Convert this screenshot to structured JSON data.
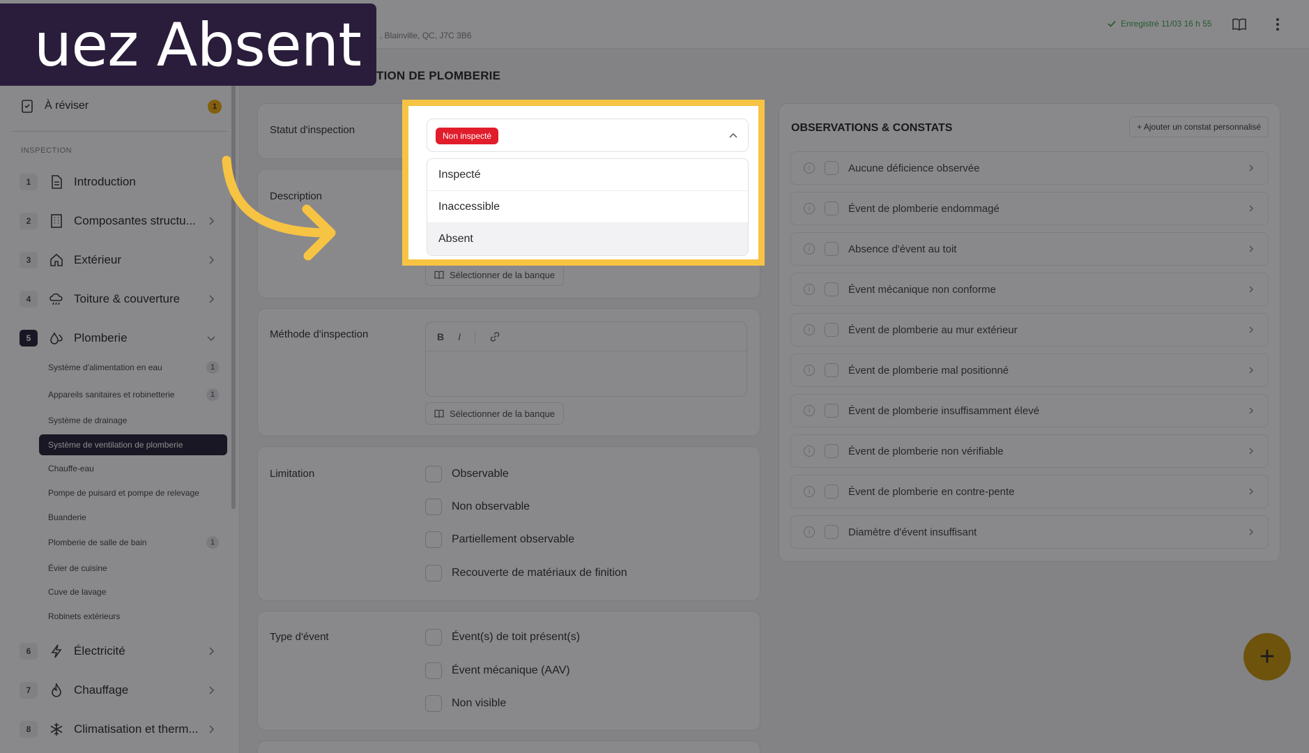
{
  "header": {
    "address": ", Blainville, QC, J7C 3B6",
    "saved_status": "Enregistré 11/03 16 h 55"
  },
  "banner": {
    "text": "uez Absent"
  },
  "page_title": "TION DE PLOMBERIE",
  "sidebar": {
    "review_label": "À réviser",
    "review_count": "1",
    "section_label": "INSPECTION",
    "items": [
      {
        "num": "1",
        "label": "Introduction"
      },
      {
        "num": "2",
        "label": "Composantes structu..."
      },
      {
        "num": "3",
        "label": "Extérieur"
      },
      {
        "num": "4",
        "label": "Toiture & couverture"
      },
      {
        "num": "5",
        "label": "Plomberie"
      },
      {
        "num": "6",
        "label": "Électricité"
      },
      {
        "num": "7",
        "label": "Chauffage"
      },
      {
        "num": "8",
        "label": "Climatisation et therm..."
      }
    ],
    "subitems": [
      {
        "label": "Système d'alimentation en eau",
        "count": "1"
      },
      {
        "label": "Appareils sanitaires et robinetterie",
        "count": "1"
      },
      {
        "label": "Système de drainage",
        "count": ""
      },
      {
        "label": "Système de ventilation de plomberie",
        "count": ""
      },
      {
        "label": "Chauffe-eau",
        "count": ""
      },
      {
        "label": "Pompe de puisard et pompe de relevage",
        "count": ""
      },
      {
        "label": "Buanderie",
        "count": ""
      },
      {
        "label": "Plomberie de salle de bain",
        "count": "1"
      },
      {
        "label": "Évier de cuisine",
        "count": ""
      },
      {
        "label": "Cuve de lavage",
        "count": ""
      },
      {
        "label": "Robinets extérieurs",
        "count": ""
      }
    ]
  },
  "form": {
    "status_label": "Statut d'inspection",
    "status_value": "Non inspecté",
    "status_options": [
      "Inspecté",
      "Inaccessible",
      "Absent"
    ],
    "description_label": "Description",
    "bank_button": "Sélectionner de la banque",
    "method_label": "Méthode d'inspection",
    "toolbar": {
      "bold": "B",
      "italic": "I"
    },
    "limitation_label": "Limitation",
    "limitation_options": [
      "Observable",
      "Non observable",
      "Partiellement observable",
      "Recouverte de matériaux de finition"
    ],
    "vent_label": "Type d'évent",
    "vent_options": [
      "Évent(s) de toit présent(s)",
      "Évent mécanique (AAV)",
      "Non visible"
    ]
  },
  "observations": {
    "title": "OBSERVATIONS & CONSTATS",
    "add_button": "+ Ajouter un constat personnalisé",
    "items": [
      "Aucune déficience observée",
      "Évent de plomberie endommagé",
      "Absence d'évent au toit",
      "Évent mécanique non conforme",
      "Évent de plomberie au mur extérieur",
      "Évent de plomberie mal positionné",
      "Évent de plomberie insuffisamment élevé",
      "Évent de plomberie non vérifiable",
      "Évent de plomberie en contre-pente",
      "Diamètre d'évent insuffisant"
    ]
  },
  "fab": {
    "label": "+"
  },
  "colors": {
    "accent": "#f7c343",
    "brand_dark": "#2a1d3b",
    "status_red": "#e11d2b",
    "fab": "#c99200"
  }
}
